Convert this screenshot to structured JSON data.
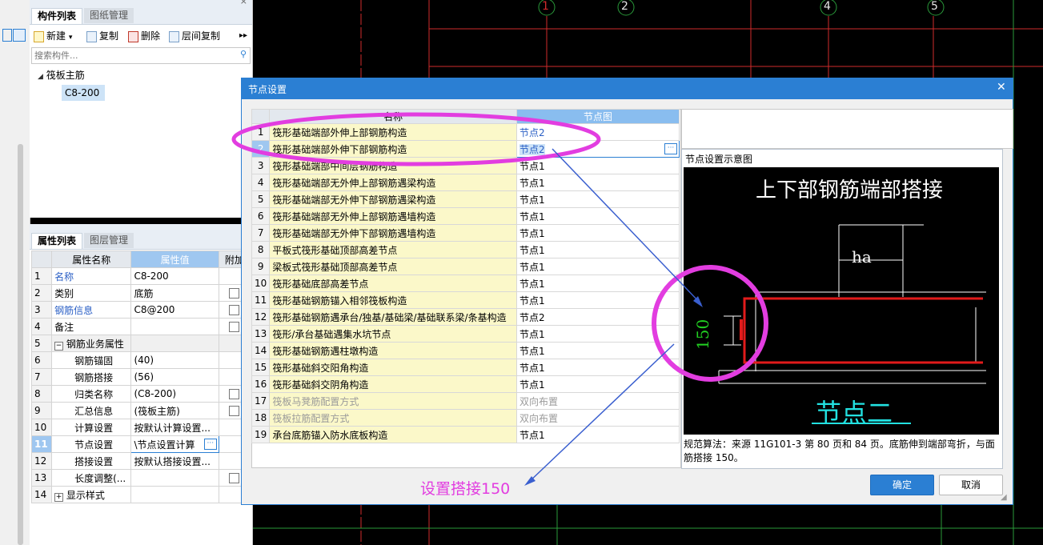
{
  "component_panel": {
    "tabs": [
      "构件列表",
      "图纸管理"
    ],
    "toolbar": {
      "new": "新建",
      "copy": "复制",
      "delete": "删除",
      "floor_copy": "层间复制"
    },
    "search_placeholder": "搜索构件...",
    "tree": {
      "root": "筏板主筋",
      "child": "C8-200"
    }
  },
  "attr_panel": {
    "tabs": [
      "属性列表",
      "图层管理"
    ],
    "headers": [
      "属性名称",
      "属性值",
      "附加"
    ],
    "rows": [
      {
        "n": "1",
        "name": "名称",
        "value": "C8-200"
      },
      {
        "n": "2",
        "name": "类别",
        "value": "底筋"
      },
      {
        "n": "3",
        "name": "钢筋信息",
        "value": "C8@200"
      },
      {
        "n": "4",
        "name": "备注",
        "value": ""
      },
      {
        "n": "5",
        "name": "钢筋业务属性",
        "value": ""
      },
      {
        "n": "6",
        "name": "钢筋锚固",
        "value": "(40)"
      },
      {
        "n": "7",
        "name": "钢筋搭接",
        "value": "(56)"
      },
      {
        "n": "8",
        "name": "归类名称",
        "value": "(C8-200)"
      },
      {
        "n": "9",
        "name": "汇总信息",
        "value": "(筏板主筋)"
      },
      {
        "n": "10",
        "name": "计算设置",
        "value": "按默认计算设置..."
      },
      {
        "n": "11",
        "name": "节点设置",
        "value": "\\节点设置计算"
      },
      {
        "n": "12",
        "name": "搭接设置",
        "value": "按默认搭接设置..."
      },
      {
        "n": "13",
        "name": "长度调整(...",
        "value": ""
      },
      {
        "n": "14",
        "name": "显示样式",
        "value": ""
      }
    ]
  },
  "axis_labels": [
    "1",
    "2",
    "4",
    "5"
  ],
  "dialog": {
    "title": "节点设置",
    "headers": [
      "名称",
      "节点图"
    ],
    "rows": [
      {
        "n": "1",
        "name": "筏形基础端部外伸上部钢筋构造",
        "value": "节点2"
      },
      {
        "n": "2",
        "name": "筏形基础端部外伸下部钢筋构造",
        "value": "节点2"
      },
      {
        "n": "3",
        "name": "筏形基础端部中间层钢筋构造",
        "value": "节点1"
      },
      {
        "n": "4",
        "name": "筏形基础端部无外伸上部钢筋遇梁构造",
        "value": "节点1"
      },
      {
        "n": "5",
        "name": "筏形基础端部无外伸下部钢筋遇梁构造",
        "value": "节点1"
      },
      {
        "n": "6",
        "name": "筏形基础端部无外伸上部钢筋遇墙构造",
        "value": "节点1"
      },
      {
        "n": "7",
        "name": "筏形基础端部无外伸下部钢筋遇墙构造",
        "value": "节点1"
      },
      {
        "n": "8",
        "name": "平板式筏形基础顶部高差节点",
        "value": "节点1"
      },
      {
        "n": "9",
        "name": "梁板式筏形基础顶部高差节点",
        "value": "节点1"
      },
      {
        "n": "10",
        "name": "筏形基础底部高差节点",
        "value": "节点1"
      },
      {
        "n": "11",
        "name": "筏形基础钢筋锚入相邻筏板构造",
        "value": "节点1"
      },
      {
        "n": "12",
        "name": "筏形基础钢筋遇承台/独基/基础梁/基础联系梁/条基构造",
        "value": "节点2"
      },
      {
        "n": "13",
        "name": "筏形/承台基础遇集水坑节点",
        "value": "节点1"
      },
      {
        "n": "14",
        "name": "筏形基础钢筋遇柱墩构造",
        "value": "节点1"
      },
      {
        "n": "15",
        "name": "筏形基础斜交阳角构造",
        "value": "节点1"
      },
      {
        "n": "16",
        "name": "筏形基础斜交阴角构造",
        "value": "节点1"
      },
      {
        "n": "17",
        "name": "筏板马凳筋配置方式",
        "value": "双向布置"
      },
      {
        "n": "18",
        "name": "筏板拉筋配置方式",
        "value": "双向布置"
      },
      {
        "n": "19",
        "name": "承台底筋锚入防水底板构造",
        "value": "节点1"
      }
    ],
    "preview_title": "节点设置示意图",
    "diagram_title": "上下部钢筋端部搭接",
    "diagram_ha": "ha",
    "diagram_150": "150",
    "diagram_node": "节点二",
    "note": "规范算法：来源 11G101-3 第 80 页和 84 页。底筋伸到端部弯折，与面筋搭接 150。",
    "ok": "确定",
    "cancel": "取消"
  },
  "annotation": {
    "text": "设置搭接150",
    "color": "#e23de0"
  }
}
